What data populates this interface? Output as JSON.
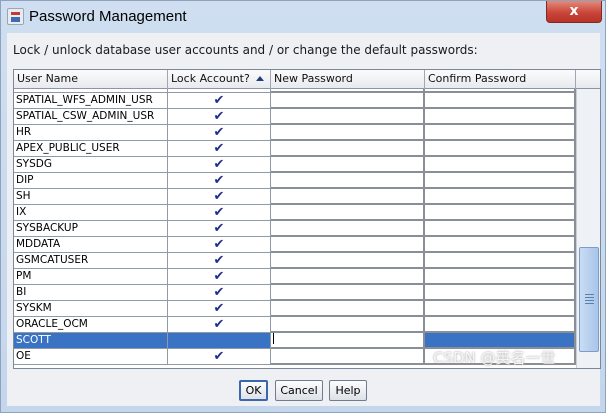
{
  "window": {
    "title": "Password Management",
    "close_label": "x"
  },
  "instruction": "Lock / unlock database user accounts and / or change the default passwords:",
  "table": {
    "columns": [
      "User Name",
      "Lock Account?",
      "New Password",
      "Confirm Password"
    ],
    "sort_column": "Lock Account?",
    "sort_direction": "ascending",
    "rows": [
      {
        "user": "",
        "locked": true,
        "new_password": "",
        "confirm_password": ""
      },
      {
        "user": "SPATIAL_WFS_ADMIN_USR",
        "locked": true,
        "new_password": "",
        "confirm_password": ""
      },
      {
        "user": "SPATIAL_CSW_ADMIN_USR",
        "locked": true,
        "new_password": "",
        "confirm_password": ""
      },
      {
        "user": "HR",
        "locked": true,
        "new_password": "",
        "confirm_password": ""
      },
      {
        "user": "APEX_PUBLIC_USER",
        "locked": true,
        "new_password": "",
        "confirm_password": ""
      },
      {
        "user": "SYSDG",
        "locked": true,
        "new_password": "",
        "confirm_password": ""
      },
      {
        "user": "DIP",
        "locked": true,
        "new_password": "",
        "confirm_password": ""
      },
      {
        "user": "SH",
        "locked": true,
        "new_password": "",
        "confirm_password": ""
      },
      {
        "user": "IX",
        "locked": true,
        "new_password": "",
        "confirm_password": ""
      },
      {
        "user": "SYSBACKUP",
        "locked": true,
        "new_password": "",
        "confirm_password": ""
      },
      {
        "user": "MDDATA",
        "locked": true,
        "new_password": "",
        "confirm_password": ""
      },
      {
        "user": "GSMCATUSER",
        "locked": true,
        "new_password": "",
        "confirm_password": ""
      },
      {
        "user": "PM",
        "locked": true,
        "new_password": "",
        "confirm_password": ""
      },
      {
        "user": "BI",
        "locked": true,
        "new_password": "",
        "confirm_password": ""
      },
      {
        "user": "SYSKM",
        "locked": true,
        "new_password": "",
        "confirm_password": ""
      },
      {
        "user": "ORACLE_OCM",
        "locked": true,
        "new_password": "",
        "confirm_password": ""
      },
      {
        "user": "SCOTT",
        "locked": false,
        "new_password": "",
        "confirm_password": "",
        "selected": true,
        "editing": true
      },
      {
        "user": "OE",
        "locked": true,
        "new_password": "",
        "confirm_password": ""
      }
    ]
  },
  "scrollbar": {
    "position_fraction": 0.62
  },
  "buttons": {
    "ok": "OK",
    "cancel": "Cancel",
    "help": "Help"
  },
  "watermark": "CSDN @英名一世",
  "colors": {
    "selection": "#3a72c4",
    "checkmark": "#1b2f8f",
    "close_button": "#c9463a"
  },
  "icons": {
    "check": "checkmark",
    "sort": "triangle-up"
  }
}
